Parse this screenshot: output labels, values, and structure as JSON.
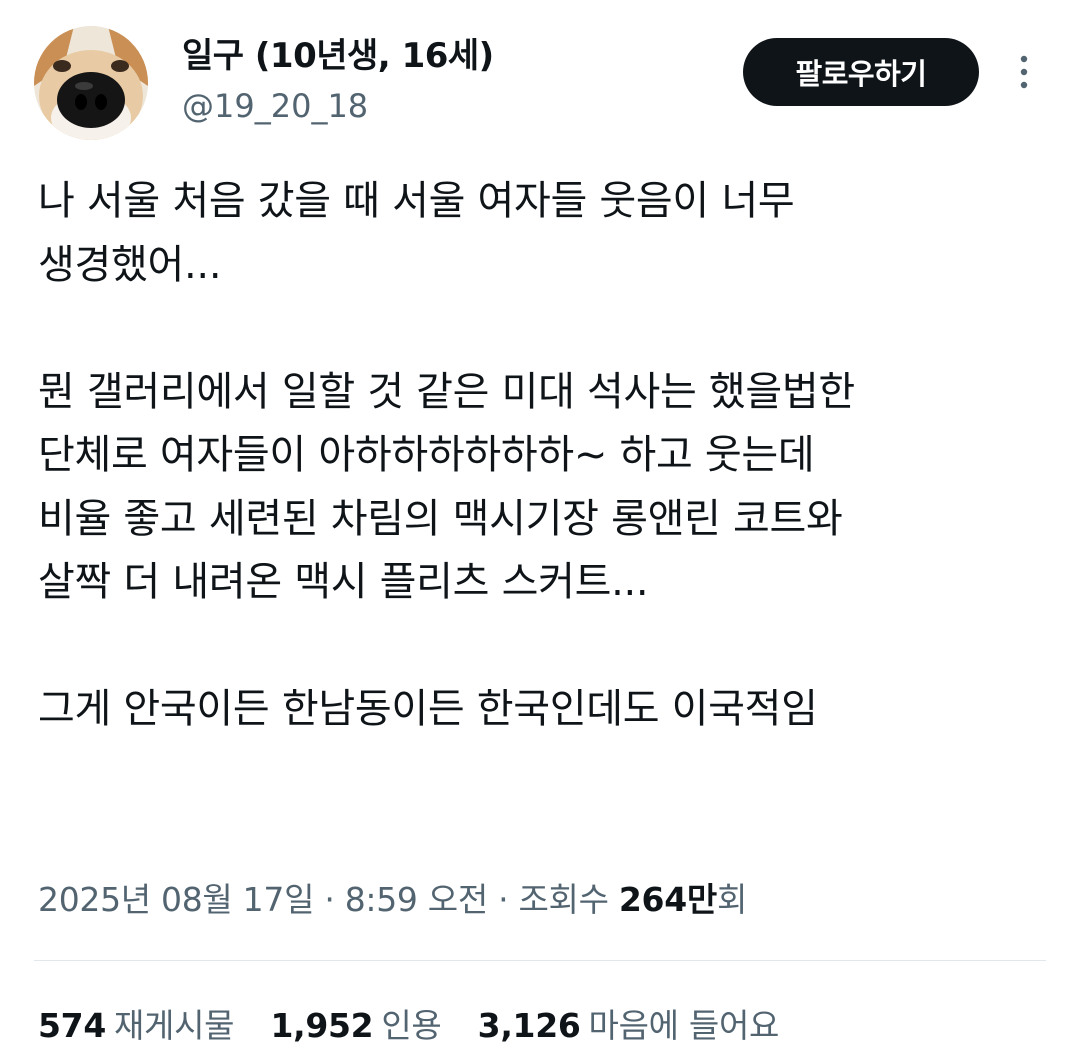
{
  "author": {
    "display_name": "일구 (10년생, 16세)",
    "handle": "@19_20_18",
    "avatar_icon": "dog-avatar-icon"
  },
  "follow_button_label": "팔로우하기",
  "more_icon": "more-vertical-icon",
  "tweet": {
    "paragraphs": [
      [
        "나 서울 처음 갔을 때 서울 여자들 웃음이 너무",
        "생경했어..."
      ],
      [
        "뭔 갤러리에서 일할 것 같은 미대 석사는 했을법한",
        "단체로 여자들이 아하하하하하하~ 하고 웃는데",
        "비율 좋고 세련된 차림의 맥시기장 롱앤린 코트와",
        "살짝 더 내려온 맥시 플리츠 스커트..."
      ],
      [
        "그게 안국이든 한남동이든 한국인데도 이국적임"
      ]
    ]
  },
  "meta": {
    "date": "2025년 08월 17일",
    "separator": " · ",
    "time": "8:59 오전",
    "views_label": "조회수",
    "views_count": "264만",
    "views_suffix": "회"
  },
  "stats": {
    "retweets": {
      "count": "574",
      "label": "재게시물"
    },
    "quotes": {
      "count": "1,952",
      "label": "인용"
    },
    "likes": {
      "count": "3,126",
      "label": "마음에 들어요"
    }
  },
  "colors": {
    "text": "#0f1419",
    "secondary": "#536471",
    "button_bg": "#0f1419",
    "button_text": "#ffffff",
    "divider": "#e3e7ea"
  }
}
